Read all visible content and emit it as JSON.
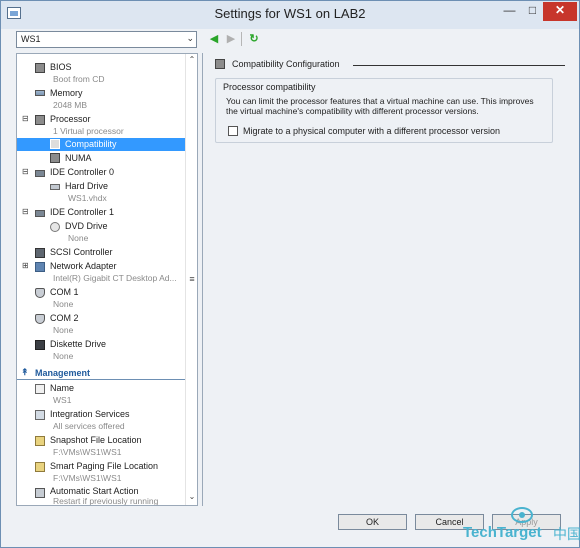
{
  "window": {
    "title": "Settings for WS1 on LAB2"
  },
  "toolbar": {
    "vm_selected": "WS1"
  },
  "tree": {
    "items": [
      {
        "label": "BIOS",
        "sub": "Boot from CD"
      },
      {
        "label": "Memory",
        "sub": "2048 MB"
      },
      {
        "label": "Processor",
        "sub": "1 Virtual processor"
      },
      {
        "label": "Compatibility"
      },
      {
        "label": "NUMA"
      },
      {
        "label": "IDE Controller 0"
      },
      {
        "label": "Hard Drive",
        "sub": "WS1.vhdx"
      },
      {
        "label": "IDE Controller 1"
      },
      {
        "label": "DVD Drive",
        "sub": "None"
      },
      {
        "label": "SCSI Controller"
      },
      {
        "label": "Network Adapter",
        "sub": "Intel(R) Gigabit CT Desktop Ad..."
      },
      {
        "label": "COM 1",
        "sub": "None"
      },
      {
        "label": "COM 2",
        "sub": "None"
      },
      {
        "label": "Diskette Drive",
        "sub": "None"
      }
    ],
    "management_header": "Management",
    "management_items": [
      {
        "label": "Name",
        "sub": "WS1"
      },
      {
        "label": "Integration Services",
        "sub": "All services offered"
      },
      {
        "label": "Snapshot File Location",
        "sub": "F:\\VMs\\WS1\\WS1"
      },
      {
        "label": "Smart Paging File Location",
        "sub": "F:\\VMs\\WS1\\WS1"
      },
      {
        "label": "Automatic Start Action",
        "sub": "Restart if previously running"
      }
    ]
  },
  "config": {
    "header": "Compatibility Configuration",
    "group_title": "Processor compatibility",
    "description": "You can limit the processor features that a virtual machine can use. This improves the virtual machine's compatibility with different processor versions.",
    "checkbox_label": "Migrate to a physical computer with a different processor version",
    "checkbox_checked": false
  },
  "buttons": {
    "ok": "OK",
    "cancel": "Cancel",
    "apply": "Apply"
  },
  "watermark": {
    "brand": "TechTarget",
    "cn": "中国"
  },
  "colors": {
    "selection": "#3399ff",
    "accent": "#1f5a9c",
    "close": "#c7362b",
    "watermark": "#49b3cf"
  }
}
